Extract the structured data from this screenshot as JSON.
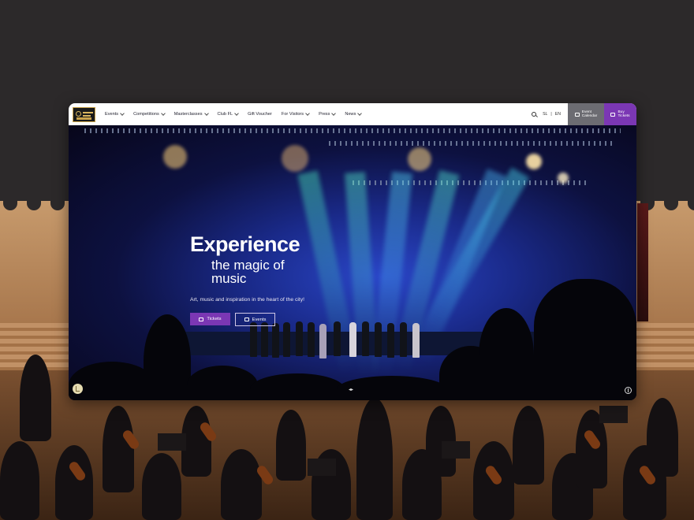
{
  "nav": {
    "logo_text": "LJUBLJANA FESTIVAL",
    "items": [
      {
        "label": "Events",
        "dropdown": true
      },
      {
        "label": "Competitions",
        "dropdown": true
      },
      {
        "label": "Masterclasses",
        "dropdown": true
      },
      {
        "label": "Club FL",
        "dropdown": true
      },
      {
        "label": "Gift Voucher",
        "dropdown": false
      },
      {
        "label": "For Visitors",
        "dropdown": true
      },
      {
        "label": "Press",
        "dropdown": true
      },
      {
        "label": "News",
        "dropdown": true
      }
    ],
    "languages": [
      "SL",
      "EN"
    ],
    "lang_separator": "|",
    "event_calendar_line1": "Event",
    "event_calendar_line2": "Calendar",
    "buy_tickets_line1": "Buy",
    "buy_tickets_line2": "Tickets"
  },
  "hero": {
    "title_line1": "Experience",
    "title_line2": "the magic of music",
    "subtitle": "Art, music and inspiration in the heart of the city!",
    "tickets_label": "Tickets",
    "events_label": "Events",
    "media_control_symbol": "◂▸"
  },
  "colors": {
    "accent_purple": "#7b37b4",
    "calendar_grey": "#6c6c72",
    "nav_bg": "#ffffff",
    "page_bg": "#2b2829"
  },
  "icons": [
    "search-icon",
    "calendar-icon",
    "ticket-icon",
    "chevron-down-icon",
    "accessibility-icon",
    "pause-icon"
  ]
}
